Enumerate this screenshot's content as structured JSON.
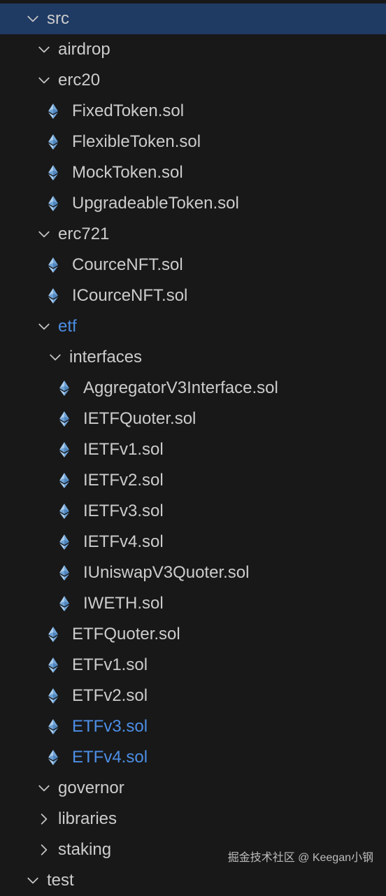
{
  "explorer": {
    "items": [
      {
        "label": "src",
        "type": "folder",
        "expanded": true,
        "level": 0,
        "selected": true
      },
      {
        "label": "airdrop",
        "type": "folder",
        "expanded": true,
        "level": 1
      },
      {
        "label": "erc20",
        "type": "folder",
        "expanded": true,
        "level": 1
      },
      {
        "label": "FixedToken.sol",
        "type": "file",
        "level": 2
      },
      {
        "label": "FlexibleToken.sol",
        "type": "file",
        "level": 2
      },
      {
        "label": "MockToken.sol",
        "type": "file",
        "level": 2
      },
      {
        "label": "UpgradeableToken.sol",
        "type": "file",
        "level": 2
      },
      {
        "label": "erc721",
        "type": "folder",
        "expanded": true,
        "level": 1
      },
      {
        "label": "CourceNFT.sol",
        "type": "file",
        "level": 2
      },
      {
        "label": "ICourceNFT.sol",
        "type": "file",
        "level": 2
      },
      {
        "label": "etf",
        "type": "folder",
        "expanded": true,
        "level": 1,
        "modified": true
      },
      {
        "label": "interfaces",
        "type": "folder",
        "expanded": true,
        "level": 2
      },
      {
        "label": "AggregatorV3Interface.sol",
        "type": "file",
        "level": 3
      },
      {
        "label": "IETFQuoter.sol",
        "type": "file",
        "level": 3
      },
      {
        "label": "IETFv1.sol",
        "type": "file",
        "level": 3
      },
      {
        "label": "IETFv2.sol",
        "type": "file",
        "level": 3
      },
      {
        "label": "IETFv3.sol",
        "type": "file",
        "level": 3
      },
      {
        "label": "IETFv4.sol",
        "type": "file",
        "level": 3
      },
      {
        "label": "IUniswapV3Quoter.sol",
        "type": "file",
        "level": 3
      },
      {
        "label": "IWETH.sol",
        "type": "file",
        "level": 3
      },
      {
        "label": "ETFQuoter.sol",
        "type": "file",
        "level": 2
      },
      {
        "label": "ETFv1.sol",
        "type": "file",
        "level": 2
      },
      {
        "label": "ETFv2.sol",
        "type": "file",
        "level": 2
      },
      {
        "label": "ETFv3.sol",
        "type": "file",
        "level": 2,
        "modified": true
      },
      {
        "label": "ETFv4.sol",
        "type": "file",
        "level": 2,
        "modified": true
      },
      {
        "label": "governor",
        "type": "folder",
        "expanded": true,
        "level": 1
      },
      {
        "label": "libraries",
        "type": "folder",
        "expanded": false,
        "level": 1
      },
      {
        "label": "staking",
        "type": "folder",
        "expanded": false,
        "level": 1
      },
      {
        "label": "test",
        "type": "folder",
        "expanded": true,
        "level": 0
      }
    ]
  },
  "icons": {
    "folder_expanded": "chevron-down-icon",
    "folder_collapsed": "chevron-right-icon",
    "file": "ethereum-solidity-icon"
  },
  "colors": {
    "background": "#181818",
    "selection": "#1f3a63",
    "text": "#cccccc",
    "modified": "#4c8ee6",
    "sol_icon": "#7fb2e0"
  },
  "watermark": "掘金技术社区 @ Keegan小钢"
}
